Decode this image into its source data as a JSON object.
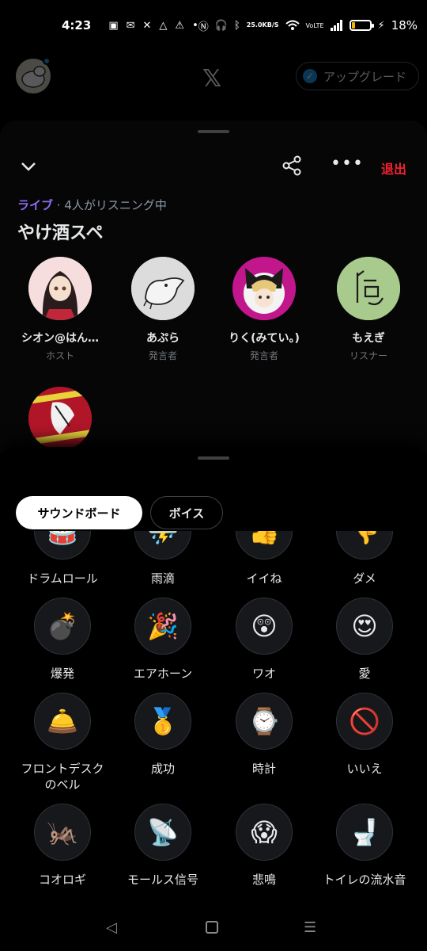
{
  "status": {
    "time": "4:23",
    "speed_top": "25.0",
    "speed_bottom": "KB/S",
    "battery_pct": "18%",
    "battery_level": 0.18,
    "battery_color": "#f5b800"
  },
  "header": {
    "logo": "𝕏",
    "upgrade_label": "アップグレード"
  },
  "space": {
    "live_tag": "ライブ",
    "listener_text": " · 4人がリスニング中",
    "title": "やけ酒スペ",
    "leave_label": "退出",
    "participants": [
      {
        "name": "シオン@はん…",
        "role": "ホスト"
      },
      {
        "name": "あぷら",
        "role": "発言者"
      },
      {
        "name": "りく(みてい。)",
        "role": "発言者"
      },
      {
        "name": "もえぎ",
        "role": "リスナー"
      },
      {
        "name": "",
        "role": ""
      }
    ]
  },
  "tabs": {
    "soundboard": "サウンドボード",
    "voice": "ボイス"
  },
  "sounds": [
    {
      "emoji": "🥁",
      "label": "ドラムロール"
    },
    {
      "emoji": "⛈️",
      "label": "雨滴"
    },
    {
      "emoji": "👍",
      "label": "イイね"
    },
    {
      "emoji": "👎",
      "label": "ダメ"
    },
    {
      "emoji": "💣",
      "label": "爆発"
    },
    {
      "emoji": "🎉",
      "label": "エアホーン"
    },
    {
      "emoji": "😲",
      "label": "ワオ"
    },
    {
      "emoji": "😍",
      "label": "愛"
    },
    {
      "emoji": "🛎️",
      "label": "フロントデスクのベル"
    },
    {
      "emoji": "🥇",
      "label": "成功"
    },
    {
      "emoji": "⌚",
      "label": "時計"
    },
    {
      "emoji": "🚫",
      "label": "いいえ"
    },
    {
      "emoji": "🦗",
      "label": "コオロギ"
    },
    {
      "emoji": "📡",
      "label": "モールス信号"
    },
    {
      "emoji": "😱",
      "label": "悲鳴"
    },
    {
      "emoji": "🚽",
      "label": "トイレの流水音"
    }
  ],
  "nav": {
    "back": "◁",
    "menu": "☰"
  },
  "colors": {
    "accent_live": "#8e6cf5",
    "leave": "#f4212e",
    "verified": "#1d9bf0"
  }
}
